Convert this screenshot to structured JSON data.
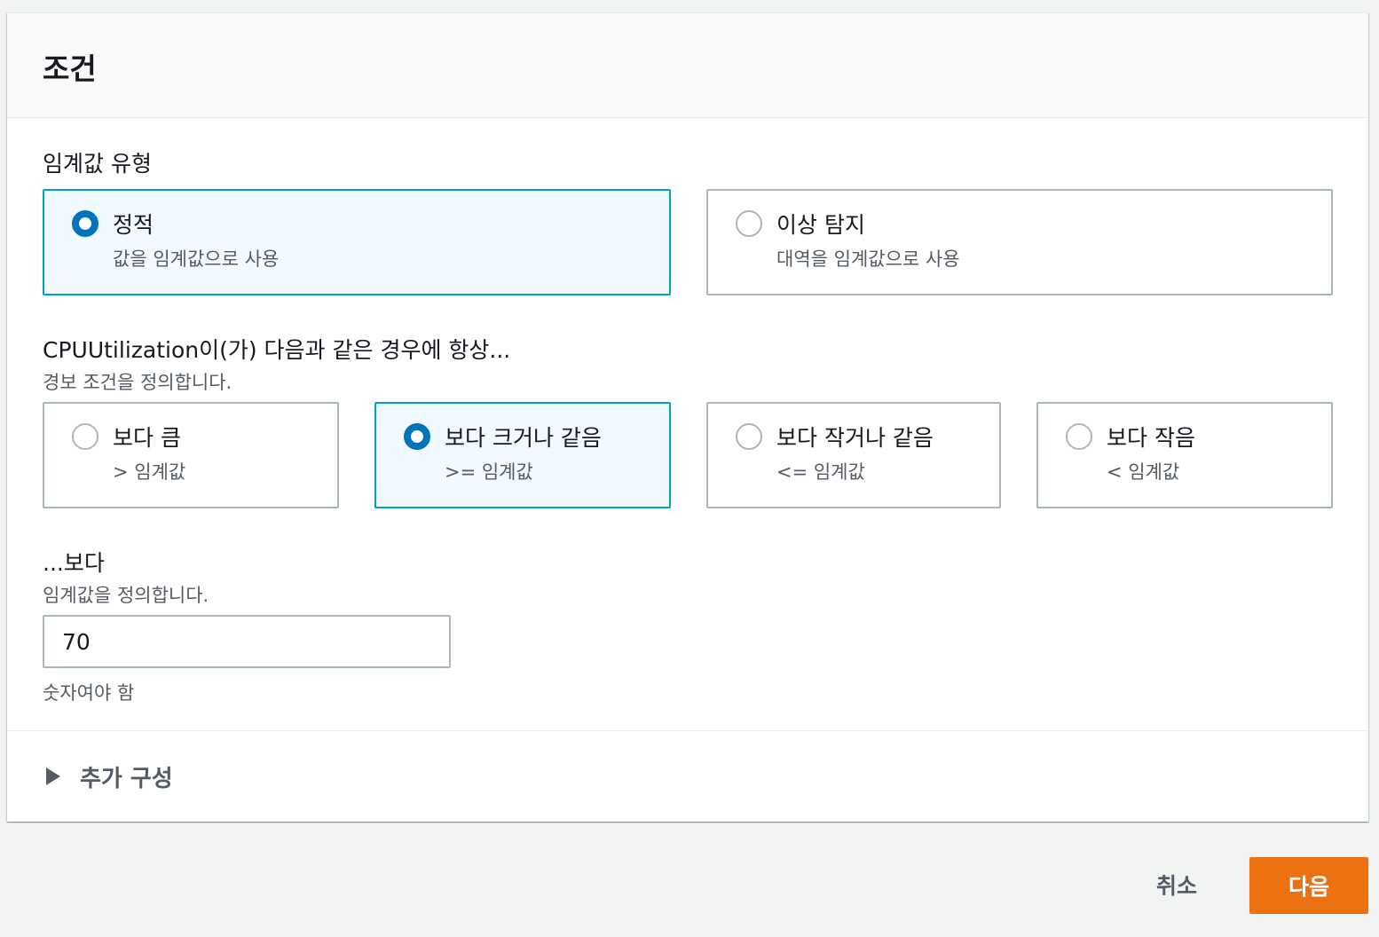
{
  "panel": {
    "title": "조건"
  },
  "threshold_type": {
    "label": "임계값 유형",
    "options": [
      {
        "title": "정적",
        "desc": "값을 임계값으로 사용",
        "selected": true
      },
      {
        "title": "이상 탐지",
        "desc": "대역을 임계값으로 사용",
        "selected": false
      }
    ]
  },
  "condition": {
    "label": "CPUUtilization이(가) 다음과 같은 경우에 항상...",
    "desc": "경보 조건을 정의합니다.",
    "options": [
      {
        "title": "보다 큼",
        "desc": "> 임계값",
        "selected": false
      },
      {
        "title": "보다 크거나 같음",
        "desc": ">= 임계값",
        "selected": true
      },
      {
        "title": "보다 작거나 같음",
        "desc": "<= 임계값",
        "selected": false
      },
      {
        "title": "보다 작음",
        "desc": "< 임계값",
        "selected": false
      }
    ]
  },
  "threshold_value": {
    "label": "...보다",
    "desc": "임계값을 정의합니다.",
    "value": "70",
    "hint": "숫자여야 함"
  },
  "additional_config": {
    "label": "추가 구성"
  },
  "footer": {
    "cancel_label": "취소",
    "next_label": "다음"
  },
  "colors": {
    "accent": "#0073bb",
    "selected_border": "#00a1c9",
    "selected_bg": "#f1faff",
    "primary_button": "#ec7211"
  }
}
